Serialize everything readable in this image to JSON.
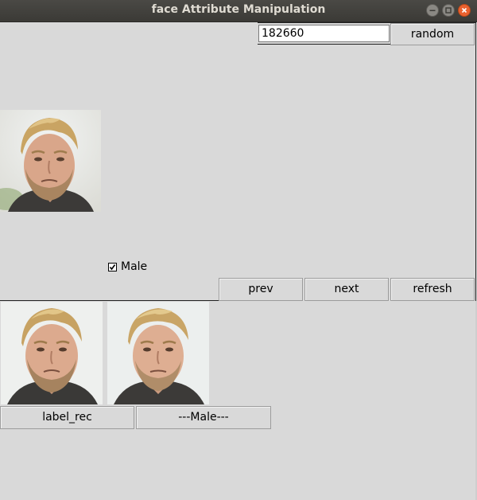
{
  "window": {
    "title": "face Attribute Manipulation",
    "controls": [
      "minimize-icon",
      "maximize-icon",
      "close-icon"
    ]
  },
  "toolbar": {
    "index_value": "182660",
    "random_label": "random"
  },
  "checkbox": {
    "label": "Male",
    "checked": true
  },
  "nav": {
    "prev_label": "prev",
    "next_label": "next",
    "refresh_label": "refresh"
  },
  "results": {
    "label_rec": "label_rec",
    "attribute_label": "---Male---"
  },
  "colors": {
    "background": "#d9d9d9",
    "titlebar": "#3e3d39",
    "close_button": "#e9612f"
  }
}
